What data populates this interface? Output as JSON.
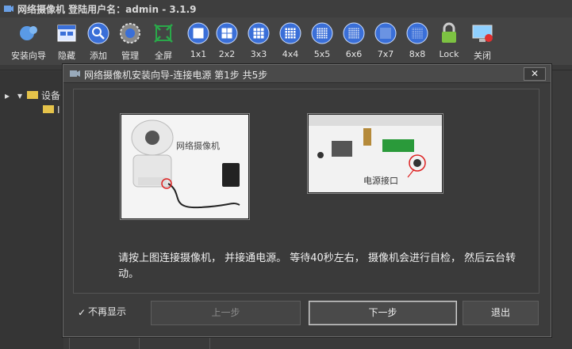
{
  "app": {
    "title": "网络摄像机  登陆用户名：admin - 3.1.9"
  },
  "toolbar": [
    {
      "label": "安装向导",
      "icon": "wizard-icon"
    },
    {
      "label": "隐藏",
      "icon": "hide-window-icon"
    },
    {
      "label": "添加",
      "icon": "search-icon"
    },
    {
      "label": "管理",
      "icon": "gear-icon"
    },
    {
      "label": "全屏",
      "icon": "fullscreen-icon"
    },
    {
      "label": "1x1",
      "icon": "layout-1x1-icon"
    },
    {
      "label": "2x2",
      "icon": "layout-2x2-icon"
    },
    {
      "label": "3x3",
      "icon": "layout-3x3-icon"
    },
    {
      "label": "4x4",
      "icon": "layout-4x4-icon"
    },
    {
      "label": "5x5",
      "icon": "layout-5x5-icon"
    },
    {
      "label": "6x6",
      "icon": "layout-6x6-icon"
    },
    {
      "label": "7x7",
      "icon": "layout-7x7-icon"
    },
    {
      "label": "8x8",
      "icon": "layout-8x8-icon"
    },
    {
      "label": "Lock",
      "icon": "lock-icon"
    },
    {
      "label": "关闭",
      "icon": "close-monitor-icon"
    }
  ],
  "tree": {
    "root": "设备",
    "child": "I"
  },
  "dialog": {
    "title": "网络摄像机安装向导-连接电源  第1步 共5步",
    "close": "✕",
    "caption_camera": "网络摄像机",
    "caption_power": "电源接口",
    "instruction": "请按上图连接摄像机， 并接通电源。 等待40秒左右， 摄像机会进行自检， 然后云台转动。",
    "checkbox_label": "不再显示",
    "checkbox_mark": "✓",
    "prev_label": "上一步",
    "next_label": "下一步",
    "exit_label": "退出"
  },
  "colors": {
    "icon_blue": "#3a6fd8",
    "accent_green": "#2aa84a",
    "lock_green": "#7dc242"
  }
}
